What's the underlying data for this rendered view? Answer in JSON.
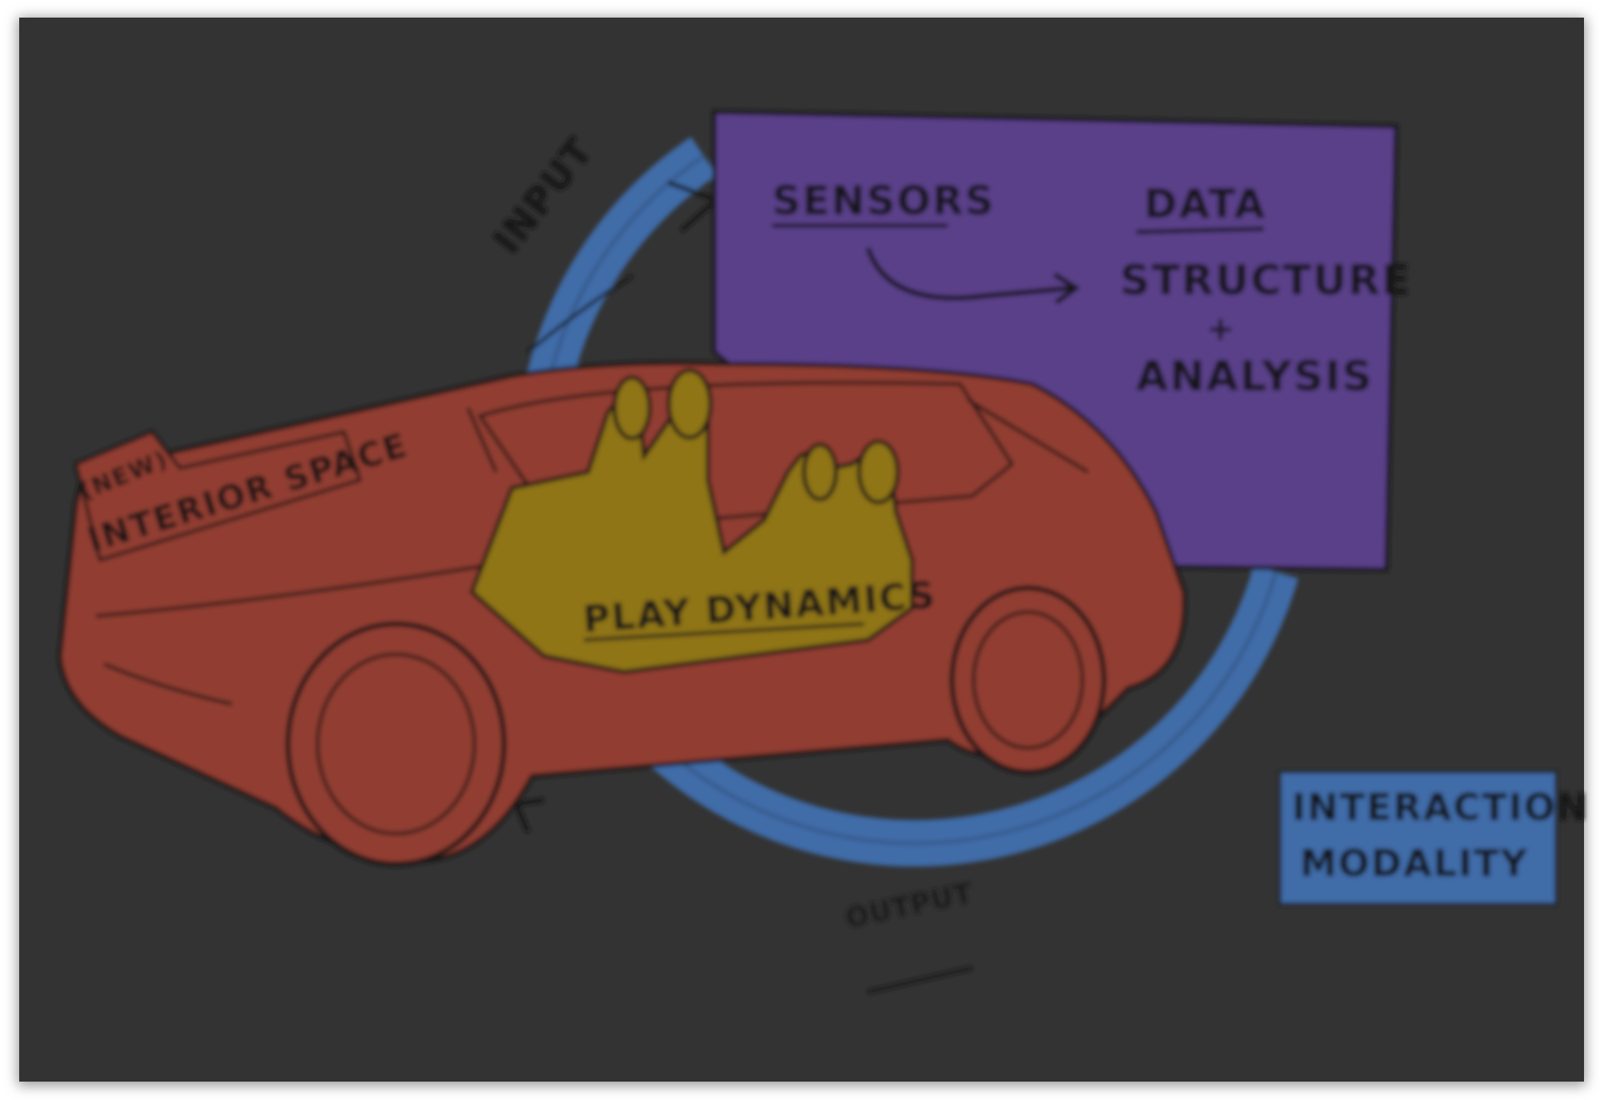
{
  "colors": {
    "background": "#ffffff",
    "board": "#333333",
    "car": "#913e32",
    "passengers": "#8f7415",
    "loop": "#3f6ca8",
    "data_box": "#5a4189",
    "interaction_box": "#3f6ca8",
    "ink": "#151515"
  },
  "loop": {
    "input_label": "INPUT",
    "output_label": "OUTPUT"
  },
  "data_box": {
    "sensors": "SENSORS",
    "data": "DATA",
    "line1": "STRUCTURE",
    "line2": "+",
    "line3": "ANALYSIS"
  },
  "car": {
    "tag": "(NEW)",
    "label": "INTERIOR SPACE"
  },
  "passengers": {
    "label": "PLAY DYNAMICS"
  },
  "interaction_box": {
    "line1": "INTERACTION",
    "line2": "MODALITY"
  }
}
